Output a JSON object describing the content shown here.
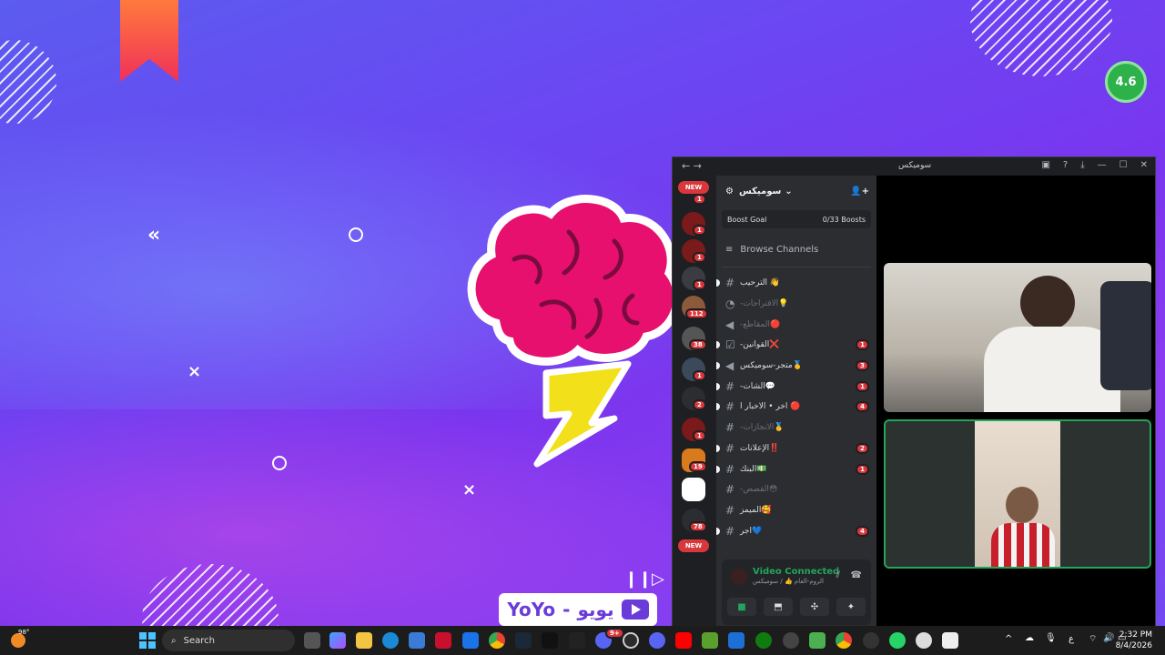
{
  "desktop": {
    "rating": "4.6",
    "logo_latin": "YoYo",
    "logo_separator": "-",
    "logo_arabic": "يويو"
  },
  "discord": {
    "window_title": "سوميكس",
    "server_name": "سوميكس",
    "boost_goal_label": "Boost Goal",
    "boost_goal_value": "0/33 Boosts",
    "browse_channels": "Browse Channels",
    "new_label": "NEW",
    "server_badges": [
      "1",
      "1",
      "1",
      "1",
      "112",
      "38",
      "1",
      "2",
      "1",
      "19",
      "78"
    ],
    "channels": [
      {
        "name": "الترحيب 👋",
        "muted": false,
        "badge": ""
      },
      {
        "name": "-الاقتراحات💡",
        "muted": true,
        "badge": ""
      },
      {
        "name": "-المقاطع🔴",
        "muted": true,
        "badge": ""
      },
      {
        "name": "-القوانين❌",
        "muted": false,
        "badge": "1"
      },
      {
        "name": "متجر-سوميكس🥇",
        "muted": false,
        "badge": "3"
      },
      {
        "name": "-الشات💬",
        "muted": false,
        "badge": "1"
      },
      {
        "name": "اخر • الاخبار ا 🔴",
        "muted": false,
        "badge": "4"
      },
      {
        "name": "-الانجازات🥇",
        "muted": true,
        "badge": ""
      },
      {
        "name": "الإعلانات‼️",
        "muted": false,
        "badge": "2"
      },
      {
        "name": "البنك💵",
        "muted": false,
        "badge": "1"
      },
      {
        "name": "-القصص😳",
        "muted": true,
        "badge": ""
      },
      {
        "name": "الميمز🥰",
        "muted": false,
        "badge": ""
      },
      {
        "name": "اجر💙",
        "muted": false,
        "badge": "4"
      }
    ],
    "voice": {
      "status": "Video Connected",
      "subtitle": "الروم-العام 👍 / سوميكس"
    }
  },
  "taskbar": {
    "search_placeholder": "Search",
    "weather_temp": "98°",
    "lang": "ع",
    "time": "2:32 PM",
    "date": "8/4/2026",
    "discord_badge": "9+"
  },
  "colors": {
    "accent_green": "#23a55a",
    "badge_red": "#da373c",
    "bg_purple": "#6b46f2"
  }
}
